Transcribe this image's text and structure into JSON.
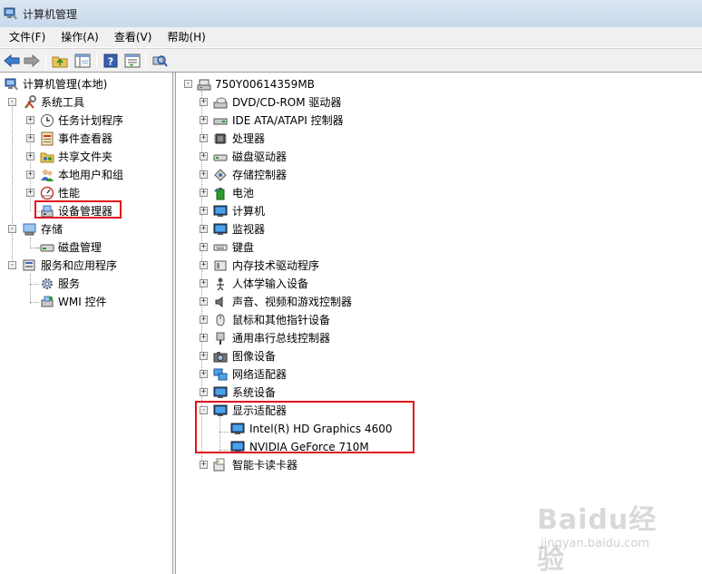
{
  "window": {
    "title": "计算机管理"
  },
  "menu": [
    {
      "label": "文件(F)"
    },
    {
      "label": "操作(A)"
    },
    {
      "label": "查看(V)"
    },
    {
      "label": "帮助(H)"
    }
  ],
  "toolbar": {
    "buttons": [
      "back-arrow-icon",
      "forward-arrow-icon",
      "up-folder-icon",
      "show-hide-tree-icon",
      "help-icon",
      "properties-icon",
      "scan-hardware-icon"
    ]
  },
  "left_tree": {
    "root": "计算机管理(本地)",
    "system_tools": "系统工具",
    "task_scheduler": "任务计划程序",
    "event_viewer": "事件查看器",
    "shared_folders": "共享文件夹",
    "local_users": "本地用户和组",
    "performance": "性能",
    "device_manager": "设备管理器",
    "storage": "存储",
    "disk_management": "磁盘管理",
    "services_apps": "服务和应用程序",
    "services": "服务",
    "wmi": "WMI 控件"
  },
  "device_tree": {
    "computer": "750Y00614359MB",
    "categories": [
      "DVD/CD-ROM 驱动器",
      "IDE ATA/ATAPI 控制器",
      "处理器",
      "磁盘驱动器",
      "存储控制器",
      "电池",
      "计算机",
      "监视器",
      "键盘",
      "内存技术驱动程序",
      "人体学输入设备",
      "声音、视频和游戏控制器",
      "鼠标和其他指针设备",
      "通用串行总线控制器",
      "图像设备",
      "网络适配器",
      "系统设备",
      "显示适配器"
    ],
    "display_adapters": [
      "Intel(R) HD Graphics 4600",
      "NVIDIA GeForce 710M"
    ],
    "last_category": "智能卡读卡器"
  },
  "watermark": {
    "main": "Baidu经验",
    "sub": "jingyan.baidu.com"
  },
  "colors": {
    "highlight_box": "#e0141c",
    "titlebar": "#c9d9ec",
    "chrome": "#f0f0f0"
  }
}
